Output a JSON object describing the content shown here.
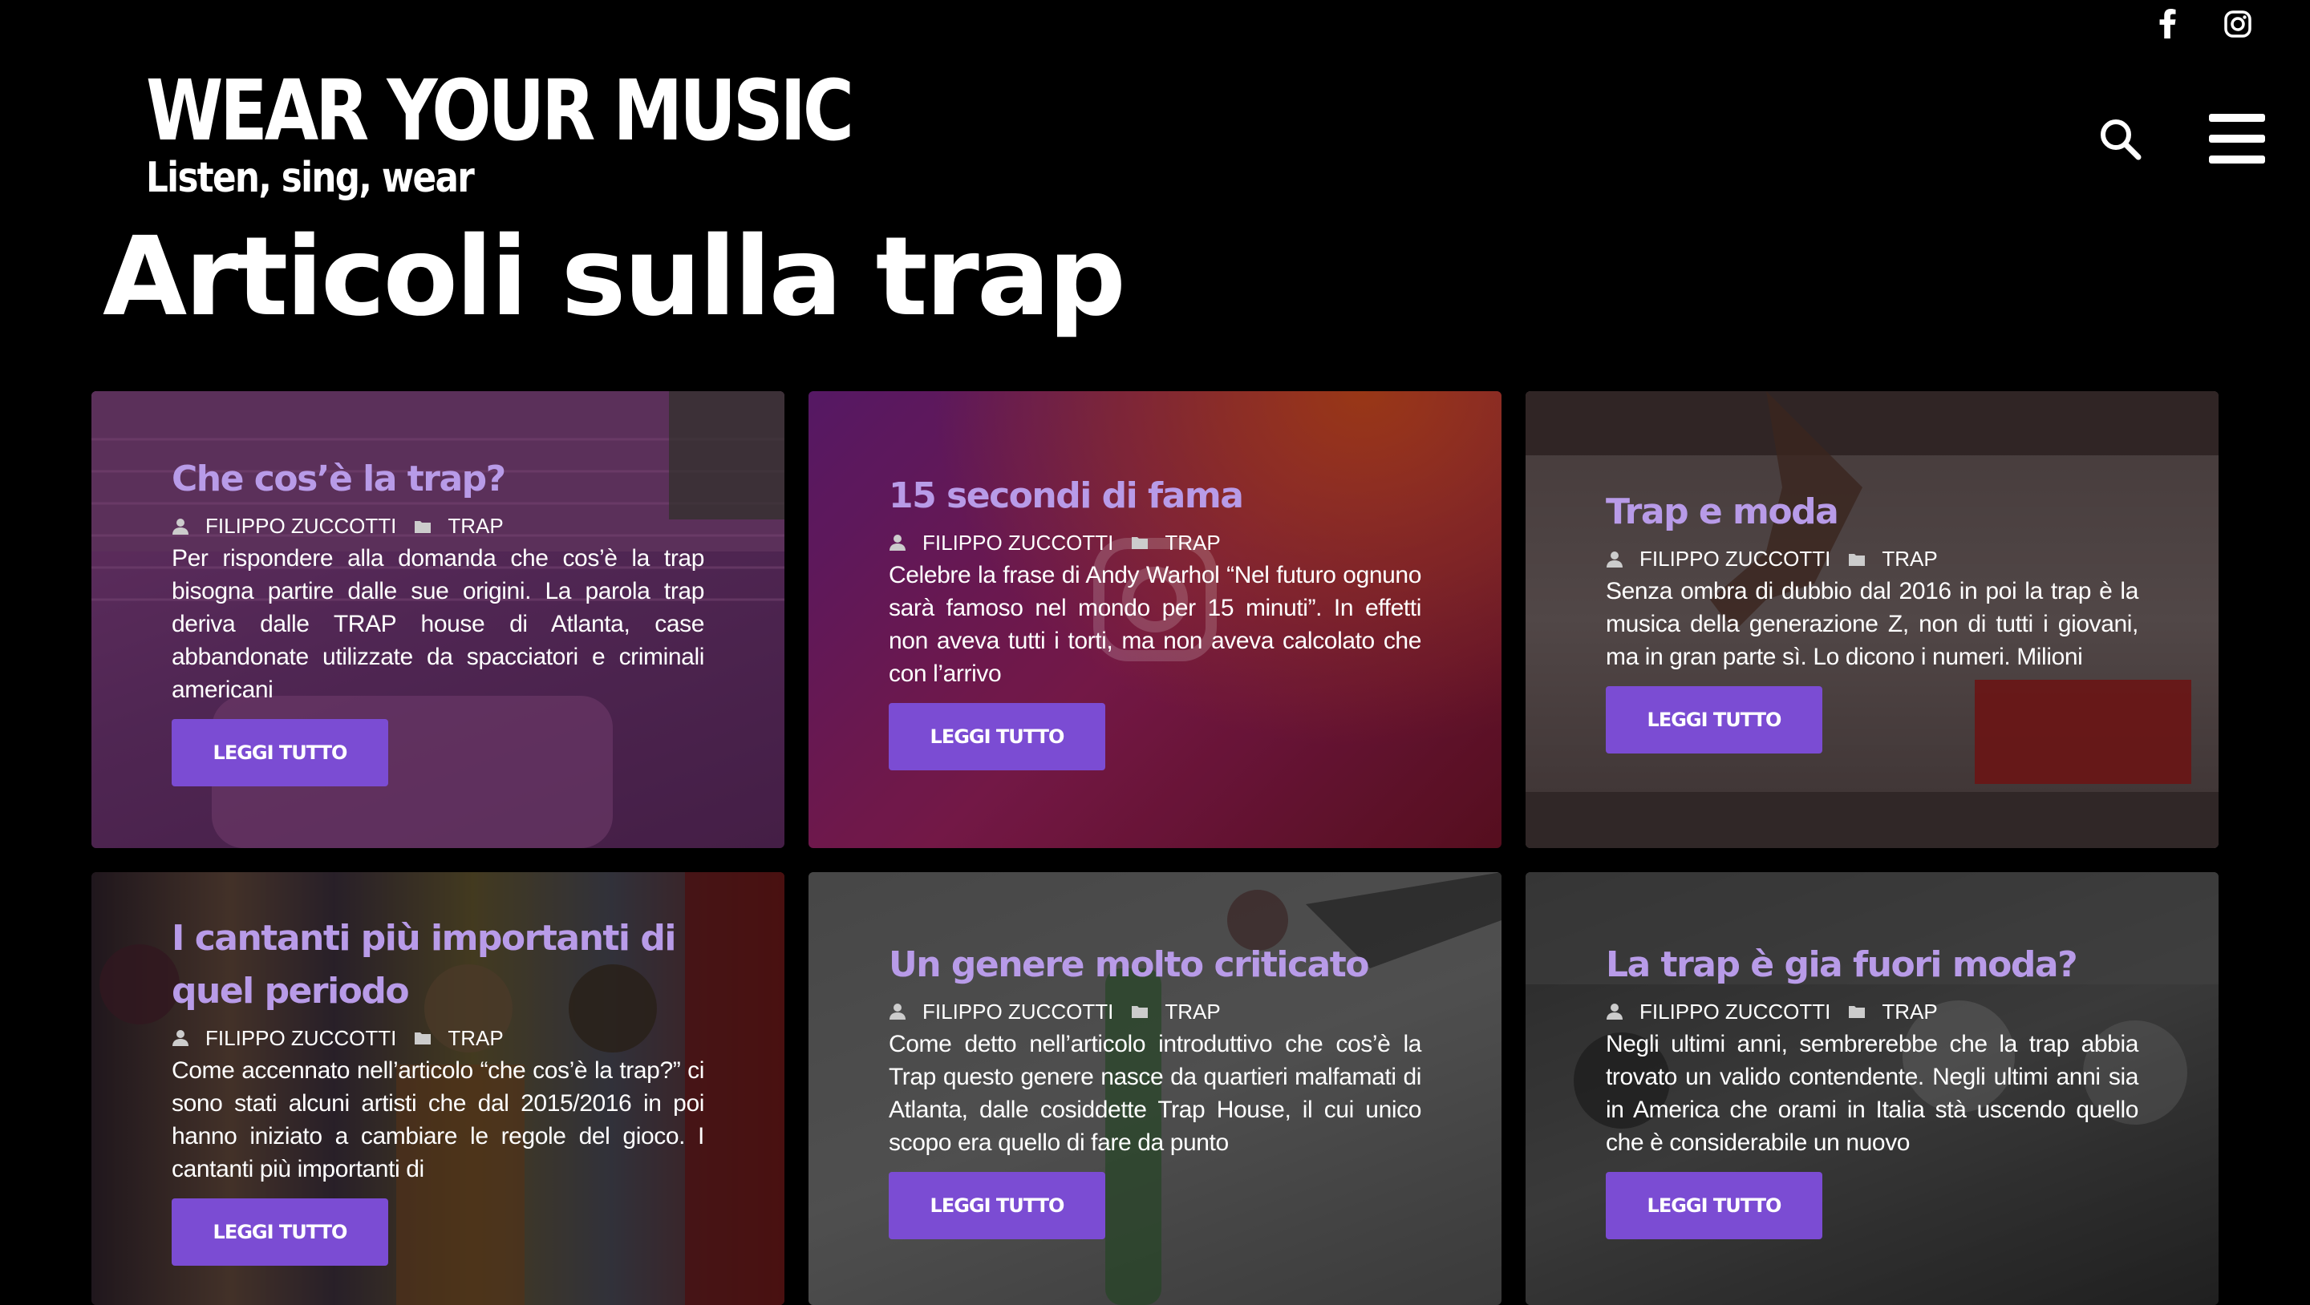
{
  "social": [
    {
      "name": "facebook-icon"
    },
    {
      "name": "instagram-icon"
    }
  ],
  "brand": {
    "title": "WEAR YOUR MUSIC",
    "tagline": "Listen, sing, wear"
  },
  "header": {
    "icons": [
      "search-icon",
      "hamburger-menu-icon"
    ]
  },
  "page": {
    "title": "Articoli sulla trap"
  },
  "articles": [
    {
      "title": "Che cos’è la trap?",
      "author": "FILIPPO ZUCCOTTI",
      "category": "TRAP",
      "excerpt": "Per rispondere alla domanda che cos’è la trap bisogna partire dalle sue origini. La parola trap deriva dalle TRAP house di Atlanta, case abbandonate utilizzate da spacciatori e criminali americani",
      "button": "LEGGI TUTTO"
    },
    {
      "title": "15 secondi di fama",
      "author": "FILIPPO ZUCCOTTI",
      "category": "TRAP",
      "excerpt": "Celebre la frase di Andy Warhol “Nel futuro ognuno sarà famoso nel mondo per 15 minuti”. In effetti non aveva tutti i torti, ma non aveva calcolato che con l’arrivo",
      "button": "LEGGI TUTTO"
    },
    {
      "title": "Trap e moda",
      "author": "FILIPPO ZUCCOTTI",
      "category": "TRAP",
      "excerpt": "Senza ombra di dubbio dal 2016 in poi la trap è la musica della generazione Z, non di tutti i giovani, ma in gran parte sì. Lo dicono i numeri. Milioni",
      "button": "LEGGI TUTTO"
    },
    {
      "title": "I cantanti più importanti di quel periodo",
      "author": "FILIPPO ZUCCOTTI",
      "category": "TRAP",
      "excerpt": "Come accennato nell’articolo “che cos’è la trap?” ci sono stati alcuni artisti che dal 2015/2016 in poi hanno iniziato a cambiare le regole del gioco. I cantanti più importanti di",
      "button": "LEGGI TUTTO"
    },
    {
      "title": "Un genere molto criticato",
      "author": "FILIPPO ZUCCOTTI",
      "category": "TRAP",
      "excerpt": "Come detto nell’articolo introduttivo che cos’è la Trap questo genere nasce da quartieri malfamati di Atlanta, dalle cosiddette Trap House, il cui unico scopo era quello di fare da punto",
      "button": "LEGGI TUTTO"
    },
    {
      "title": "La trap è gia fuori moda?",
      "author": "FILIPPO ZUCCOTTI",
      "category": "TRAP",
      "excerpt": "Negli ultimi anni, sembrerebbe che la trap abbia trovato un valido contendente. Negli ultimi anni sia in America che orami in Italia stà uscendo quello che è considerabile un nuovo",
      "button": "LEGGI TUTTO"
    }
  ],
  "colors": {
    "background": "#000000",
    "accent": "#7b4cd3",
    "card_title": "#b89be8"
  }
}
